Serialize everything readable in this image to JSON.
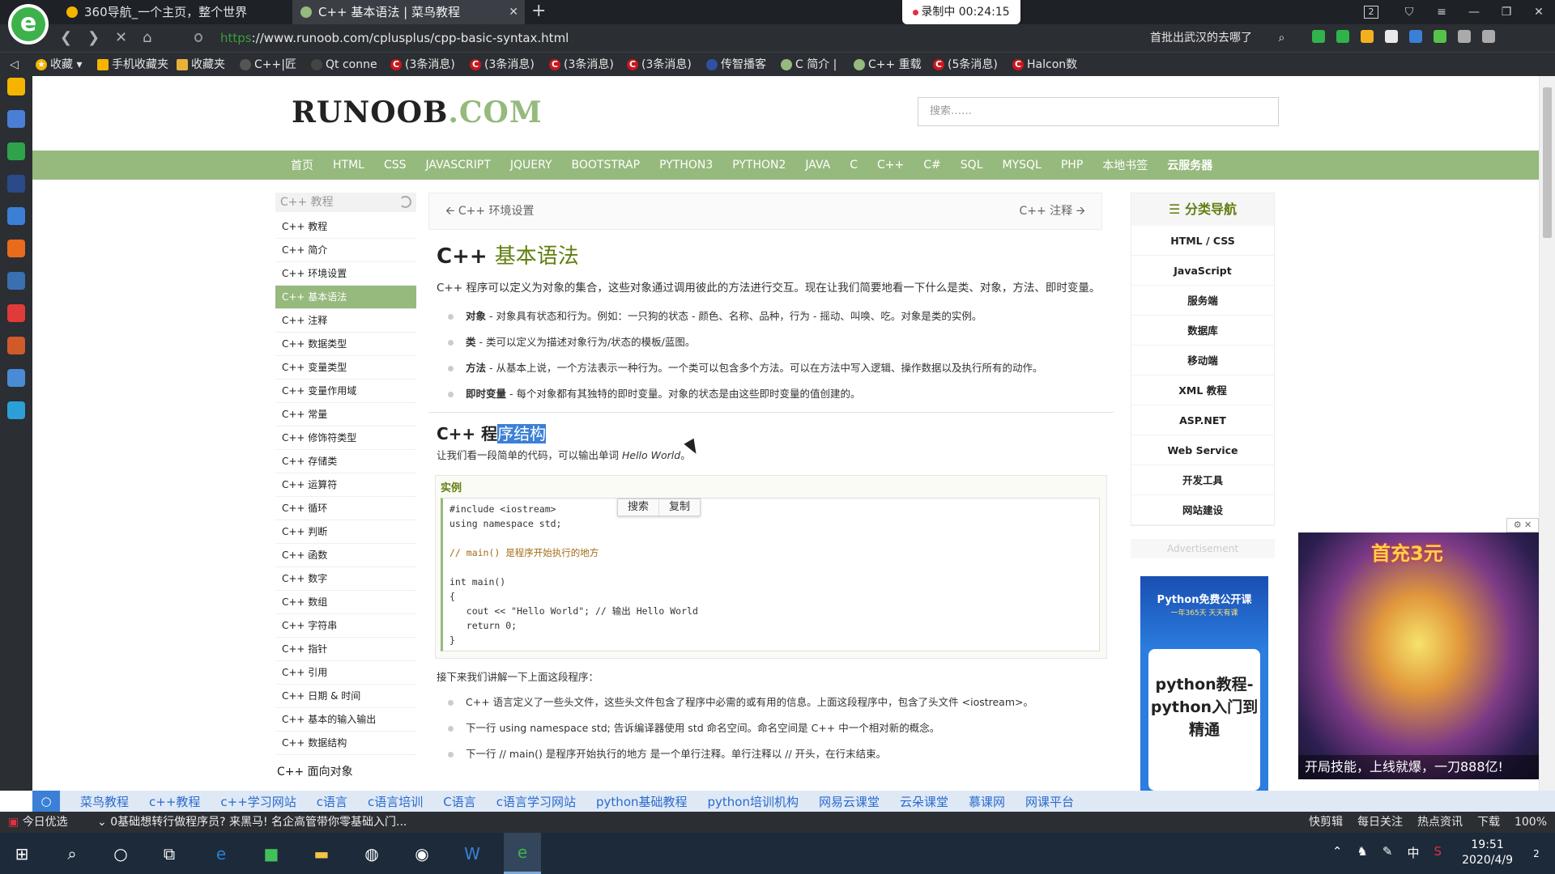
{
  "browser": {
    "tabs": [
      {
        "label": "360导航_一个主页，整个世界",
        "active": false
      },
      {
        "label": "C++ 基本语法 | 菜鸟教程",
        "active": true
      }
    ],
    "recording": "录制中 00:24:15",
    "tab_count": "2",
    "url_protocol": "https",
    "url_rest": "://www.runoob.com/cplusplus/cpp-basic-syntax.html",
    "address_search": "首批出武汉的去哪了",
    "bookmarks": [
      "收藏",
      "手机收藏夹",
      "收藏夹",
      "C++|匠",
      "Qt conne",
      "(3条消息)",
      "(3条消息)",
      "(3条消息)",
      "(3条消息)",
      "传智播客",
      "C 简介 |",
      "C++ 重载",
      "(5条消息)",
      "Halcon数"
    ]
  },
  "site": {
    "logo_main": "RUNOOB",
    "logo_suffix": ".COM",
    "search_placeholder": "搜索……",
    "nav": [
      "首页",
      "HTML",
      "CSS",
      "JAVASCRIPT",
      "JQUERY",
      "BOOTSTRAP",
      "PYTHON3",
      "PYTHON2",
      "JAVA",
      "C",
      "C++",
      "C#",
      "SQL",
      "MYSQL",
      "PHP",
      "本地书签",
      "云服务器"
    ]
  },
  "sidebar": {
    "header": "C++ 教程",
    "items": [
      "C++ 教程",
      "C++ 简介",
      "C++ 环境设置",
      "C++ 基本语法",
      "C++ 注释",
      "C++ 数据类型",
      "C++ 变量类型",
      "C++ 变量作用域",
      "C++ 常量",
      "C++ 修饰符类型",
      "C++ 存储类",
      "C++ 运算符",
      "C++ 循环",
      "C++ 判断",
      "C++ 函数",
      "C++ 数字",
      "C++ 数组",
      "C++ 字符串",
      "C++ 指针",
      "C++ 引用",
      "C++ 日期 & 时间",
      "C++ 基本的输入输出",
      "C++ 数据结构"
    ],
    "active_index": 3,
    "group2": "C++ 面向对象"
  },
  "article": {
    "prev": "C++ 环境设置",
    "next": "C++ 注释",
    "title_prefix": "C++",
    "title_main": "基本语法",
    "intro": "C++ 程序可以定义为对象的集合，这些对象通过调用彼此的方法进行交互。现在让我们简要地看一下什么是类、对象，方法、即时变量。",
    "bullets": [
      {
        "term": "对象",
        "text": " - 对象具有状态和行为。例如：一只狗的状态 - 颜色、名称、品种，行为 - 摇动、叫唤、吃。对象是类的实例。"
      },
      {
        "term": "类",
        "text": " - 类可以定义为描述对象行为/状态的模板/蓝图。"
      },
      {
        "term": "方法",
        "text": " - 从基本上说，一个方法表示一种行为。一个类可以包含多个方法。可以在方法中写入逻辑、操作数据以及执行所有的动作。"
      },
      {
        "term": "即时变量",
        "text": " - 每个对象都有其独特的即时变量。对象的状态是由这些即时变量的值创建的。"
      }
    ],
    "popup": [
      "搜索",
      "复制"
    ],
    "h2_plain": "C++ 程",
    "h2_selected": "序结构",
    "h2_intro": "让我们看一段简单的代码，可以输出单词 ",
    "h2_intro_em": "Hello World",
    "h2_intro_end": "。",
    "example_label": "实例",
    "code_lines": [
      "#include <iostream>",
      "using namespace std;",
      "",
      "// main() 是程序开始执行的地方",
      "",
      "int main()",
      "{",
      "   cout << \"Hello World\"; // 输出 Hello World",
      "   return 0;",
      "}"
    ],
    "after": "接下来我们讲解一下上面这段程序：",
    "bullets2": [
      "C++ 语言定义了一些头文件，这些头文件包含了程序中必需的或有用的信息。上面这段程序中，包含了头文件 <iostream>。",
      "下一行 using namespace std; 告诉编译器使用 std 命名空间。命名空间是 C++ 中一个相对新的概念。",
      "下一行 // main() 是程序开始执行的地方 是一个单行注释。单行注释以 // 开头，在行末结束。"
    ]
  },
  "rightnav": {
    "header": "分类导航",
    "items": [
      "HTML / CSS",
      "JavaScript",
      "服务端",
      "数据库",
      "移动端",
      "XML 教程",
      "ASP.NET",
      "Web Service",
      "开发工具",
      "网站建设"
    ],
    "ad_label": "Advertisement"
  },
  "ads": {
    "python_top": "Python免费公开课",
    "python_sub": "一年365天 天天有课",
    "python_card": "python教程-python入门到精通",
    "game_title": "首充3元",
    "game_bottom": "开局技能，上线就爆，一刀888亿!"
  },
  "linkbar": [
    "菜鸟教程",
    "c++教程",
    "c++学习网站",
    "c语言",
    "c语言培训",
    "C语言",
    "c语言学习网站",
    "python基础教程",
    "python培训机构",
    "网易云课堂",
    "云朵课堂",
    "慕课网",
    "网课平台"
  ],
  "status": {
    "left": "今日优选",
    "news": "0基础想转行做程序员? 来黑马! 名企高管带你零基础入门...",
    "right": [
      "快剪辑",
      "每日关注",
      "热点资讯",
      "下载",
      "100%"
    ]
  },
  "taskbar": {
    "time": "19:51",
    "date": "2020/4/9",
    "ime": "中",
    "notif": "2"
  },
  "colors": {
    "accent": "#96b97d",
    "title_green": "#617f10",
    "link_blue": "#2a6bcc"
  }
}
